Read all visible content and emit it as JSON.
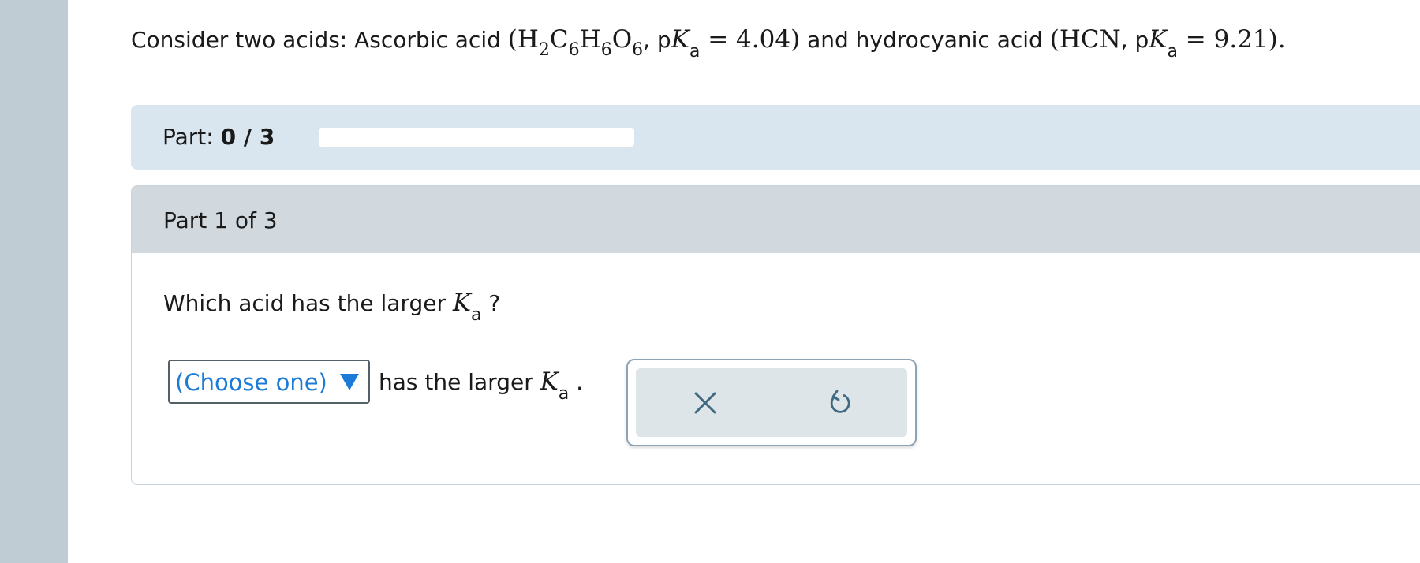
{
  "stem": {
    "intro": "Consider two acids: Ascorbic acid ",
    "acid1_open": "(H",
    "acid1_s1": "2",
    "acid1_c": "C",
    "acid1_s2": "6",
    "acid1_h": "H",
    "acid1_s3": "6",
    "acid1_o": "O",
    "acid1_s4": "6",
    "acid1_comma": ", p",
    "acid1_K": "K",
    "acid1_a": "a",
    "acid1_val": " = 4.04)",
    "mid": " and hydrocyanic acid ",
    "acid2_formula": "(HCN",
    "acid2_comma": ", p",
    "acid2_K": "K",
    "acid2_a": "a",
    "acid2_val": " = 9.21)",
    "end": "."
  },
  "progress": {
    "label": "Part: ",
    "value": "0 / 3",
    "fraction": 0
  },
  "part": {
    "title": "Part 1 of 3",
    "prompt_text": "Which acid has the larger ",
    "prompt_K": "K",
    "prompt_a": "a",
    "prompt_q": " ?",
    "select_value": "(Choose one)",
    "suffix_text": "has the larger ",
    "suffix_K": "K",
    "suffix_a": "a",
    "suffix_end": " ."
  },
  "tools": {
    "clear_icon": "x-icon",
    "undo_icon": "undo-icon",
    "icon_color": "#3f6a82"
  },
  "colors": {
    "accent": "#1c7bd6",
    "progress_bg": "#d9e6ef",
    "header_bg": "#d1d9df",
    "rail": "#c0ccd3"
  }
}
